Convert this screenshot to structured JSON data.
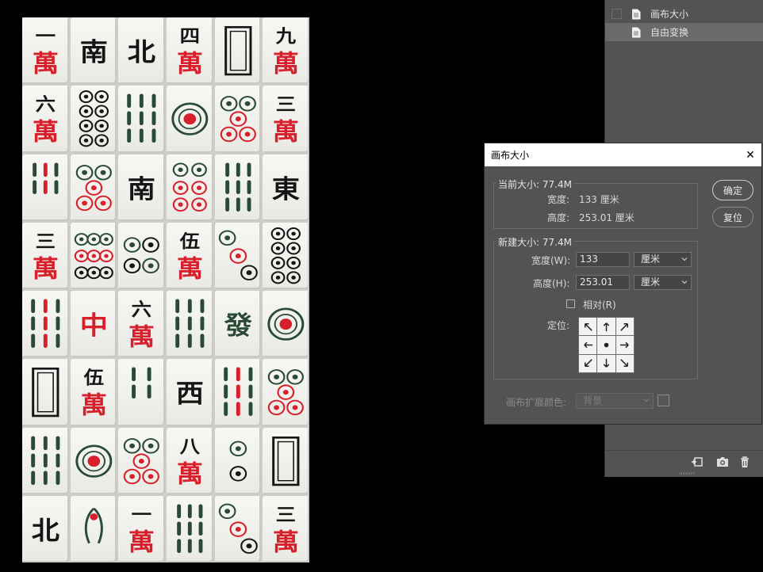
{
  "history": {
    "items": [
      {
        "label": "画布大小",
        "selected": false
      },
      {
        "label": "自由变换",
        "selected": true
      }
    ],
    "icons": [
      "new-snapshot-icon",
      "camera-icon",
      "trash-icon"
    ]
  },
  "dialog": {
    "title": "画布大小",
    "close_glyph": "✕",
    "current_size": {
      "legend": "当前大小: 77.4M",
      "width_label": "宽度:",
      "width_value": "133 厘米",
      "height_label": "高度:",
      "height_value": "253.01 厘米"
    },
    "new_size": {
      "legend": "新建大小: 77.4M",
      "width_label": "宽度(W):",
      "width_value": "133",
      "width_unit": "厘米",
      "height_label": "高度(H):",
      "height_value": "253.01",
      "height_unit": "厘米",
      "relative_label": "相对(R)",
      "relative_checked": false,
      "anchor_label": "定位:"
    },
    "extension_color_label": "画布扩展颜色:",
    "extension_color_value": "背景",
    "ok_label": "确定",
    "reset_label": "复位"
  },
  "tiles": [
    [
      "1-wan",
      "south",
      "north",
      "4-wan",
      "white-dragon",
      "9-wan"
    ],
    [
      "6-wan",
      "8-dots",
      "6-bamboo",
      "1-dots",
      "5-dots",
      "3-wan"
    ],
    [
      "5-bamboo",
      "5-dots",
      "south",
      "6-dots",
      "8-bamboo",
      "east"
    ],
    [
      "3-wan",
      "9-dots",
      "4-dots",
      "5-wan",
      "3-dots",
      "8-dots"
    ],
    [
      "9-bamboo",
      "red-dragon",
      "6-wan",
      "6-bamboo",
      "green-dragon",
      "1-dots"
    ],
    [
      "white-dragon",
      "5-wan",
      "4-bamboo",
      "west",
      "9-bamboo",
      "5-dots"
    ],
    [
      "6-bamboo",
      "1-dots",
      "5-dots",
      "8-wan",
      "2-dots",
      "white-dragon"
    ],
    [
      "north",
      "1-bamboo",
      "1-wan",
      "8-bamboo",
      "3-dots",
      "3-wan"
    ]
  ],
  "tile_glyphs": {
    "1-wan": [
      "一",
      "萬"
    ],
    "4-wan": [
      "四",
      "萬"
    ],
    "9-wan": [
      "九",
      "萬"
    ],
    "6-wan": [
      "六",
      "萬"
    ],
    "3-wan": [
      "三",
      "萬"
    ],
    "5-wan": [
      "伍",
      "萬"
    ],
    "8-wan": [
      "八",
      "萬"
    ],
    "south": "南",
    "north": "北",
    "east": "東",
    "west": "西",
    "red-dragon": "中",
    "green-dragon": "發"
  },
  "colors": {
    "tile_red": "#d8202c",
    "tile_green": "#2a4a36",
    "tile_black": "#151515"
  }
}
